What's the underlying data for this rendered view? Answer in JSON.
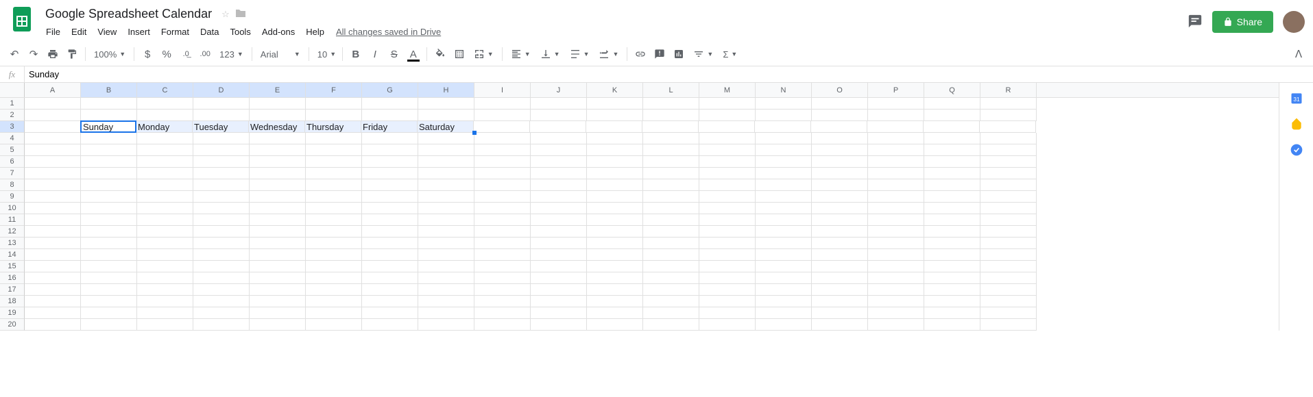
{
  "doc": {
    "title": "Google Spreadsheet Calendar"
  },
  "menu": {
    "file": "File",
    "edit": "Edit",
    "view": "View",
    "insert": "Insert",
    "format": "Format",
    "data": "Data",
    "tools": "Tools",
    "addons": "Add-ons",
    "help": "Help",
    "save_status": "All changes saved in Drive"
  },
  "toolbar": {
    "zoom": "100%",
    "font": "Arial",
    "size": "10",
    "currency": "$",
    "percent": "%",
    "dec_less": ".0",
    "dec_more": ".00",
    "more_fmt": "123",
    "share_label": "Share"
  },
  "formula": {
    "fx": "fx",
    "value": "Sunday"
  },
  "columns": [
    "A",
    "B",
    "C",
    "D",
    "E",
    "F",
    "G",
    "H",
    "I",
    "J",
    "K",
    "L",
    "M",
    "N",
    "O",
    "P",
    "Q",
    "R"
  ],
  "selected_cols": [
    "B",
    "C",
    "D",
    "E",
    "F",
    "G",
    "H"
  ],
  "active_cell": "B3",
  "selection_end": "H3",
  "row_count": 20,
  "cells": {
    "B3": "Sunday",
    "C3": "Monday",
    "D3": "Tuesday",
    "E3": "Wednesday",
    "F3": "Thursday",
    "G3": "Friday",
    "H3": "Saturday"
  }
}
